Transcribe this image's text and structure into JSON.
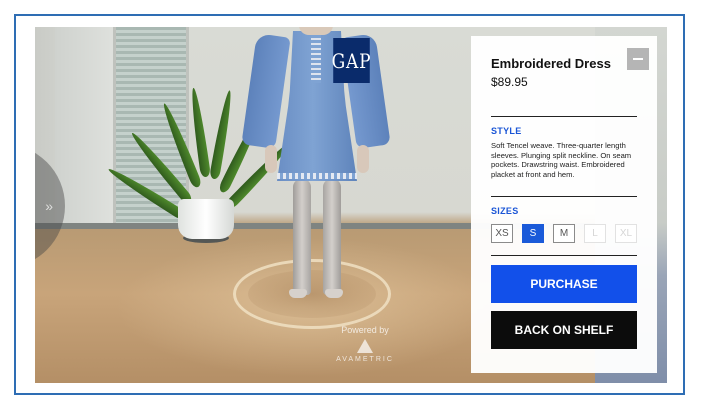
{
  "overlay": {
    "logo_text": "GAP",
    "carousel_handle_icon": "double-chevron-right-icon",
    "watermark": {
      "powered_by": "Powered by",
      "brand": "AVAMETRIC",
      "icon": "avametric-logo-icon"
    }
  },
  "product_panel": {
    "collapse_icon": "minus-icon",
    "title": "Embroidered Dress",
    "price": "$89.95",
    "style": {
      "label": "STYLE",
      "description": "Soft Tencel weave. Three-quarter length sleeves. Plunging split neckline. On seam pockets. Drawstring waist. Embroidered placket at front and hem."
    },
    "sizes": {
      "label": "SIZES",
      "options": [
        {
          "label": "XS",
          "state": "available"
        },
        {
          "label": "S",
          "state": "selected"
        },
        {
          "label": "M",
          "state": "available"
        },
        {
          "label": "L",
          "state": "unavailable"
        },
        {
          "label": "XL",
          "state": "unavailable"
        }
      ]
    },
    "purchase_label": "PURCHASE",
    "back_on_shelf_label": "BACK ON SHELF"
  },
  "colors": {
    "frame_border": "#2e6db4",
    "accent_blue": "#1250ea",
    "selected_size": "#1a5ad9",
    "section_label": "#1a55d6",
    "shelf_button": "#0c0c0c",
    "logo_background": "#0a2b6b"
  }
}
